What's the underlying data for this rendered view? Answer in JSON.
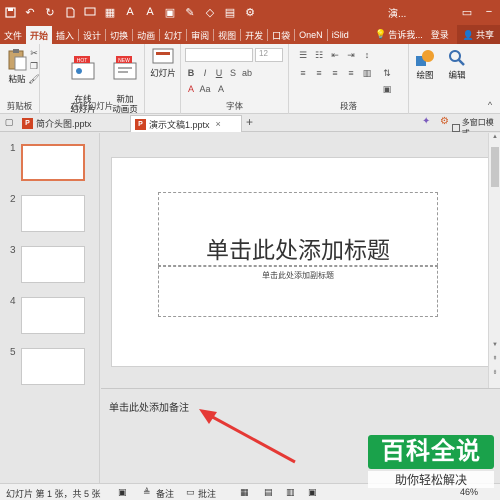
{
  "titlebar": {
    "doc_title": "演...",
    "icons": [
      "save-icon",
      "undo-icon",
      "redo-icon",
      "new-icon",
      "slideshow-icon",
      "font-icon",
      "settings-icon"
    ]
  },
  "tabs": {
    "items": [
      "文件",
      "开始",
      "插入",
      "设计",
      "切换",
      "动画",
      "幻灯",
      "审阅",
      "视图",
      "开发",
      "口袋",
      "OneN",
      "iSlid"
    ],
    "active": "开始",
    "tell_me": "告诉我...",
    "login": "登录",
    "share": "共享"
  },
  "ribbon": {
    "paste": "粘贴",
    "clipboard_group": "剪贴板",
    "online_slides": "在线\n幻灯片",
    "new_online": "新加\n动画页",
    "online_group": "在线幻灯片",
    "hot_badge": "HOT",
    "new_badge": "NEW",
    "slides_btn": "幻灯片",
    "font_size": "12",
    "font_group": "字体",
    "paragraph_group": "段落",
    "draw": "绘图",
    "edit": "编辑",
    "bold": "B",
    "italic": "I",
    "underline": "U",
    "strike": "S"
  },
  "doctabs": {
    "tab1": "简介头图.pptx",
    "tab2": "演示文稿1.pptx",
    "close": "×",
    "add": "+",
    "multi_window": "多窗口模式"
  },
  "thumbnails": [
    {
      "num": "1"
    },
    {
      "num": "2"
    },
    {
      "num": "3"
    },
    {
      "num": "4"
    },
    {
      "num": "5"
    }
  ],
  "slide": {
    "title_placeholder": "单击此处添加标题",
    "subtitle_placeholder": "单击此处添加副标题"
  },
  "notes": {
    "placeholder": "单击此处添加备注"
  },
  "status": {
    "slide_info": "幻灯片 第 1 张，共 5 张",
    "notes_btn": "备注",
    "comments_btn": "批注",
    "zoom": "46%"
  },
  "watermark": {
    "logo": "百科全说",
    "tagline": "助你轻松解决"
  },
  "colors": {
    "accent": "#b7472a",
    "selected_thumb": "#e07850",
    "arrow": "#e53935",
    "watermark_green": "#1aa24b"
  }
}
